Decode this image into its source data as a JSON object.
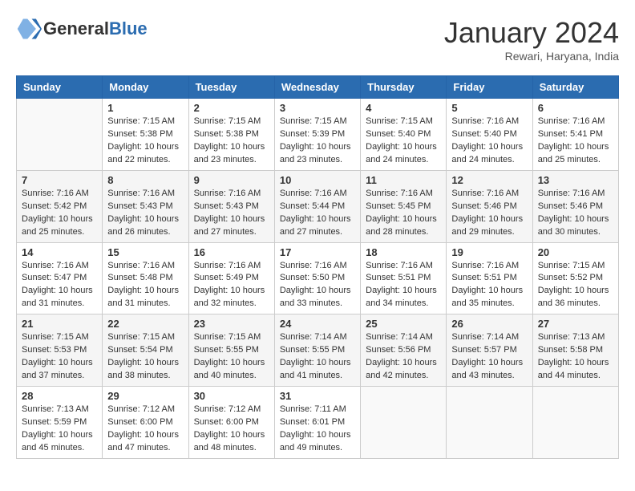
{
  "logo": {
    "general": "General",
    "blue": "Blue"
  },
  "header": {
    "month": "January 2024",
    "location": "Rewari, Haryana, India"
  },
  "weekdays": [
    "Sunday",
    "Monday",
    "Tuesday",
    "Wednesday",
    "Thursday",
    "Friday",
    "Saturday"
  ],
  "weeks": [
    [
      {
        "day": "",
        "info": ""
      },
      {
        "day": "1",
        "info": "Sunrise: 7:15 AM\nSunset: 5:38 PM\nDaylight: 10 hours\nand 22 minutes."
      },
      {
        "day": "2",
        "info": "Sunrise: 7:15 AM\nSunset: 5:38 PM\nDaylight: 10 hours\nand 23 minutes."
      },
      {
        "day": "3",
        "info": "Sunrise: 7:15 AM\nSunset: 5:39 PM\nDaylight: 10 hours\nand 23 minutes."
      },
      {
        "day": "4",
        "info": "Sunrise: 7:15 AM\nSunset: 5:40 PM\nDaylight: 10 hours\nand 24 minutes."
      },
      {
        "day": "5",
        "info": "Sunrise: 7:16 AM\nSunset: 5:40 PM\nDaylight: 10 hours\nand 24 minutes."
      },
      {
        "day": "6",
        "info": "Sunrise: 7:16 AM\nSunset: 5:41 PM\nDaylight: 10 hours\nand 25 minutes."
      }
    ],
    [
      {
        "day": "7",
        "info": "Sunrise: 7:16 AM\nSunset: 5:42 PM\nDaylight: 10 hours\nand 25 minutes."
      },
      {
        "day": "8",
        "info": "Sunrise: 7:16 AM\nSunset: 5:43 PM\nDaylight: 10 hours\nand 26 minutes."
      },
      {
        "day": "9",
        "info": "Sunrise: 7:16 AM\nSunset: 5:43 PM\nDaylight: 10 hours\nand 27 minutes."
      },
      {
        "day": "10",
        "info": "Sunrise: 7:16 AM\nSunset: 5:44 PM\nDaylight: 10 hours\nand 27 minutes."
      },
      {
        "day": "11",
        "info": "Sunrise: 7:16 AM\nSunset: 5:45 PM\nDaylight: 10 hours\nand 28 minutes."
      },
      {
        "day": "12",
        "info": "Sunrise: 7:16 AM\nSunset: 5:46 PM\nDaylight: 10 hours\nand 29 minutes."
      },
      {
        "day": "13",
        "info": "Sunrise: 7:16 AM\nSunset: 5:46 PM\nDaylight: 10 hours\nand 30 minutes."
      }
    ],
    [
      {
        "day": "14",
        "info": "Sunrise: 7:16 AM\nSunset: 5:47 PM\nDaylight: 10 hours\nand 31 minutes."
      },
      {
        "day": "15",
        "info": "Sunrise: 7:16 AM\nSunset: 5:48 PM\nDaylight: 10 hours\nand 31 minutes."
      },
      {
        "day": "16",
        "info": "Sunrise: 7:16 AM\nSunset: 5:49 PM\nDaylight: 10 hours\nand 32 minutes."
      },
      {
        "day": "17",
        "info": "Sunrise: 7:16 AM\nSunset: 5:50 PM\nDaylight: 10 hours\nand 33 minutes."
      },
      {
        "day": "18",
        "info": "Sunrise: 7:16 AM\nSunset: 5:51 PM\nDaylight: 10 hours\nand 34 minutes."
      },
      {
        "day": "19",
        "info": "Sunrise: 7:16 AM\nSunset: 5:51 PM\nDaylight: 10 hours\nand 35 minutes."
      },
      {
        "day": "20",
        "info": "Sunrise: 7:15 AM\nSunset: 5:52 PM\nDaylight: 10 hours\nand 36 minutes."
      }
    ],
    [
      {
        "day": "21",
        "info": "Sunrise: 7:15 AM\nSunset: 5:53 PM\nDaylight: 10 hours\nand 37 minutes."
      },
      {
        "day": "22",
        "info": "Sunrise: 7:15 AM\nSunset: 5:54 PM\nDaylight: 10 hours\nand 38 minutes."
      },
      {
        "day": "23",
        "info": "Sunrise: 7:15 AM\nSunset: 5:55 PM\nDaylight: 10 hours\nand 40 minutes."
      },
      {
        "day": "24",
        "info": "Sunrise: 7:14 AM\nSunset: 5:55 PM\nDaylight: 10 hours\nand 41 minutes."
      },
      {
        "day": "25",
        "info": "Sunrise: 7:14 AM\nSunset: 5:56 PM\nDaylight: 10 hours\nand 42 minutes."
      },
      {
        "day": "26",
        "info": "Sunrise: 7:14 AM\nSunset: 5:57 PM\nDaylight: 10 hours\nand 43 minutes."
      },
      {
        "day": "27",
        "info": "Sunrise: 7:13 AM\nSunset: 5:58 PM\nDaylight: 10 hours\nand 44 minutes."
      }
    ],
    [
      {
        "day": "28",
        "info": "Sunrise: 7:13 AM\nSunset: 5:59 PM\nDaylight: 10 hours\nand 45 minutes."
      },
      {
        "day": "29",
        "info": "Sunrise: 7:12 AM\nSunset: 6:00 PM\nDaylight: 10 hours\nand 47 minutes."
      },
      {
        "day": "30",
        "info": "Sunrise: 7:12 AM\nSunset: 6:00 PM\nDaylight: 10 hours\nand 48 minutes."
      },
      {
        "day": "31",
        "info": "Sunrise: 7:11 AM\nSunset: 6:01 PM\nDaylight: 10 hours\nand 49 minutes."
      },
      {
        "day": "",
        "info": ""
      },
      {
        "day": "",
        "info": ""
      },
      {
        "day": "",
        "info": ""
      }
    ]
  ]
}
